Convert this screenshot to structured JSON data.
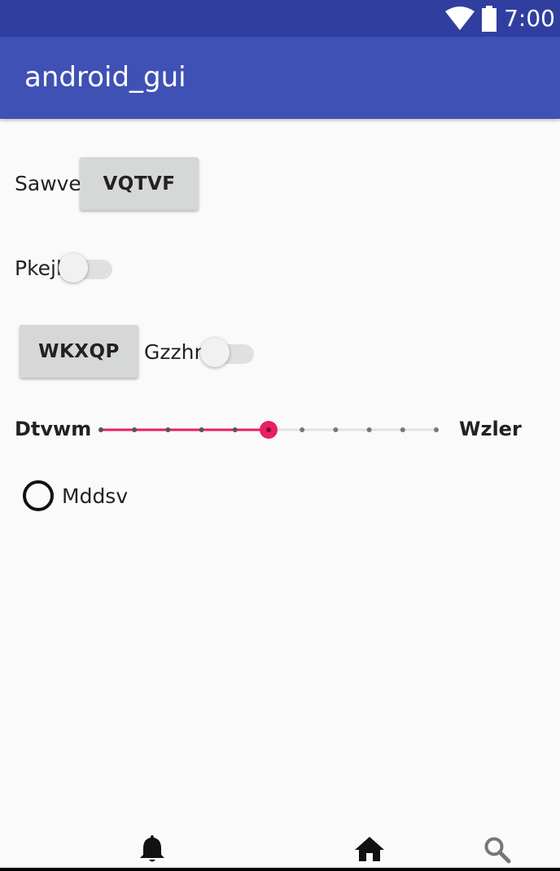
{
  "status_bar": {
    "time": "7:00"
  },
  "app_bar": {
    "title": "android_gui"
  },
  "row1": {
    "label": "Sawve",
    "button": "VQTVF"
  },
  "row2": {
    "label": "Pkejl",
    "switch_on": false
  },
  "row3": {
    "button": "WKXQP",
    "label": "Gzzhn",
    "switch_on": false
  },
  "slider": {
    "left_label": "Dtvwm",
    "right_label": "Wzler",
    "min": 0,
    "max": 10,
    "value": 5,
    "accent": "#e91e63"
  },
  "radio": {
    "label": "Mddsv",
    "checked": false
  },
  "bottom_nav": {
    "icons": [
      "bell-icon",
      "home-icon",
      "search-icon"
    ]
  },
  "colors": {
    "status_bar": "#303f9f",
    "app_bar": "#3f51b5",
    "accent": "#e91e63"
  }
}
